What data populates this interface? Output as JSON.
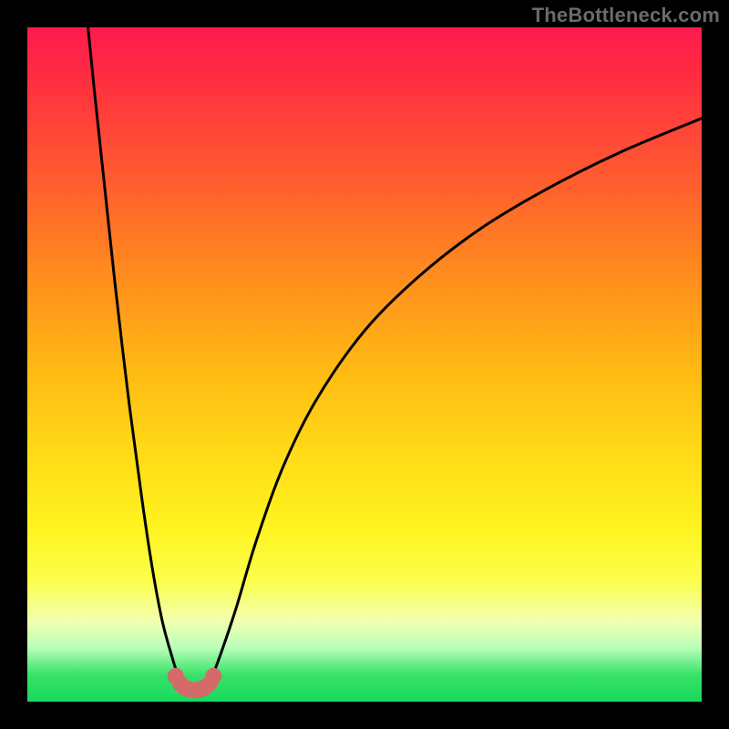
{
  "watermark": "TheBottleneck.com",
  "colors": {
    "frame": "#000000",
    "curve": "#000000",
    "marker": "#d46a6a",
    "gradient_top": "#ff1a4d",
    "gradient_bottom": "#16d95c"
  },
  "chart_data": {
    "type": "line",
    "title": "",
    "xlabel": "",
    "ylabel": "",
    "xlim": [
      0,
      100
    ],
    "ylim": [
      0,
      100
    ],
    "grid": false,
    "series": [
      {
        "name": "left-branch",
        "x": [
          9.0,
          10.0,
          11.5,
          13.0,
          15.0,
          17.0,
          18.5,
          20.0,
          21.5,
          22.5,
          23.3
        ],
        "y": [
          100.0,
          90.0,
          76.0,
          62.0,
          45.0,
          30.0,
          20.0,
          12.0,
          6.5,
          3.5,
          2.3
        ]
      },
      {
        "name": "right-branch",
        "x": [
          26.3,
          27.5,
          29.0,
          31.0,
          34.0,
          38.0,
          43.0,
          50.0,
          58.0,
          67.0,
          77.0,
          88.0,
          100.0
        ],
        "y": [
          2.3,
          4.0,
          8.0,
          14.0,
          24.0,
          35.0,
          45.0,
          55.0,
          63.0,
          70.0,
          76.0,
          81.5,
          86.5
        ]
      },
      {
        "name": "valley-markers",
        "x": [
          22.0,
          22.7,
          23.3,
          24.0,
          24.8,
          25.5,
          26.3,
          27.0,
          27.6
        ],
        "y": [
          3.8,
          2.7,
          2.1,
          1.8,
          1.7,
          1.8,
          2.1,
          2.7,
          3.8
        ]
      }
    ],
    "annotations": []
  }
}
